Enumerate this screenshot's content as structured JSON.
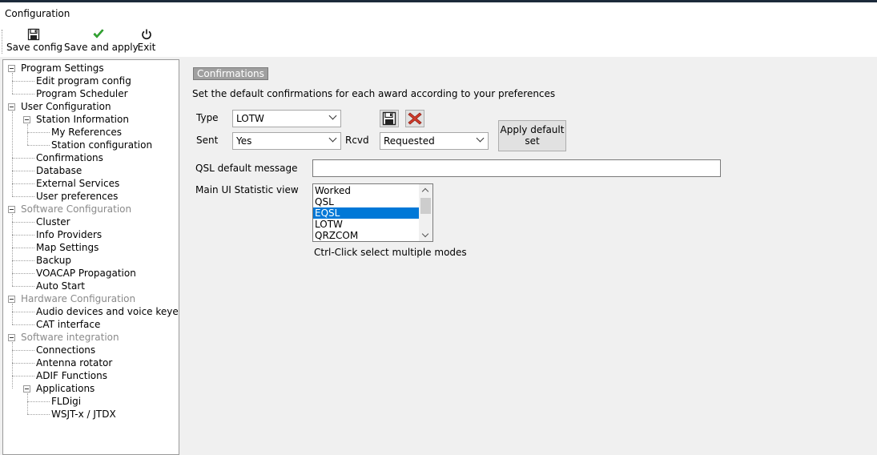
{
  "window": {
    "title": "Configuration"
  },
  "toolbar": {
    "save_config": "Save config",
    "save_and_apply": "Save and apply",
    "exit": "Exit"
  },
  "tree": {
    "items": [
      {
        "label": "Program Settings",
        "level": 0,
        "group": true,
        "disabled": false
      },
      {
        "label": "Edit program config",
        "level": 1,
        "group": false,
        "disabled": false
      },
      {
        "label": "Program Scheduler",
        "level": 1,
        "group": false,
        "disabled": false
      },
      {
        "label": "User Configuration",
        "level": 0,
        "group": true,
        "disabled": false
      },
      {
        "label": "Station Information",
        "level": 1,
        "group": true,
        "disabled": false
      },
      {
        "label": "My References",
        "level": 2,
        "group": false,
        "disabled": false
      },
      {
        "label": "Station configuration",
        "level": 2,
        "group": false,
        "disabled": false
      },
      {
        "label": "Confirmations",
        "level": 1,
        "group": false,
        "disabled": false
      },
      {
        "label": "Database",
        "level": 1,
        "group": false,
        "disabled": false
      },
      {
        "label": "External Services",
        "level": 1,
        "group": false,
        "disabled": false
      },
      {
        "label": "User preferences",
        "level": 1,
        "group": false,
        "disabled": false
      },
      {
        "label": "Software Configuration",
        "level": 0,
        "group": true,
        "disabled": true
      },
      {
        "label": "Cluster",
        "level": 1,
        "group": false,
        "disabled": false
      },
      {
        "label": "Info Providers",
        "level": 1,
        "group": false,
        "disabled": false
      },
      {
        "label": "Map Settings",
        "level": 1,
        "group": false,
        "disabled": false
      },
      {
        "label": "Backup",
        "level": 1,
        "group": false,
        "disabled": false
      },
      {
        "label": "VOACAP Propagation",
        "level": 1,
        "group": false,
        "disabled": false
      },
      {
        "label": "Auto Start",
        "level": 1,
        "group": false,
        "disabled": false
      },
      {
        "label": "Hardware Configuration",
        "level": 0,
        "group": true,
        "disabled": true
      },
      {
        "label": "Audio devices and voice keyer",
        "level": 1,
        "group": false,
        "disabled": false
      },
      {
        "label": "CAT interface",
        "level": 1,
        "group": false,
        "disabled": false
      },
      {
        "label": "Software integration",
        "level": 0,
        "group": true,
        "disabled": true
      },
      {
        "label": "Connections",
        "level": 1,
        "group": false,
        "disabled": false
      },
      {
        "label": "Antenna rotator",
        "level": 1,
        "group": false,
        "disabled": false
      },
      {
        "label": "ADIF Functions",
        "level": 1,
        "group": false,
        "disabled": false
      },
      {
        "label": "Applications",
        "level": 1,
        "group": true,
        "disabled": false
      },
      {
        "label": "FLDigi",
        "level": 2,
        "group": false,
        "disabled": false
      },
      {
        "label": "WSJT-x / JTDX",
        "level": 2,
        "group": false,
        "disabled": false
      }
    ]
  },
  "main": {
    "section_badge": "Confirmations",
    "description": "Set the default confirmations for each award according to your preferences",
    "type_label": "Type",
    "type_value": "LOTW",
    "sent_label": "Sent",
    "sent_value": "Yes",
    "rcvd_label": "Rcvd",
    "rcvd_value": "Requested",
    "apply_default_line1": "Apply default",
    "apply_default_line2": "set",
    "qsl_label": "QSL default message",
    "qsl_value": "",
    "stat_label": "Main UI Statistic view",
    "stat_options": [
      "Worked",
      "QSL",
      "EQSL",
      "LOTW",
      "QRZCOM"
    ],
    "stat_selected": "EQSL",
    "hint": "Ctrl-Click select multiple modes"
  },
  "colors": {
    "selection": "#0078d7",
    "save_icon_green": "#3cb83c",
    "delete_icon_red": "#d03a2a"
  },
  "icons": [
    "floppy-disk-icon",
    "checkmark-icon",
    "power-icon",
    "save-floppy-icon",
    "delete-x-icon"
  ]
}
